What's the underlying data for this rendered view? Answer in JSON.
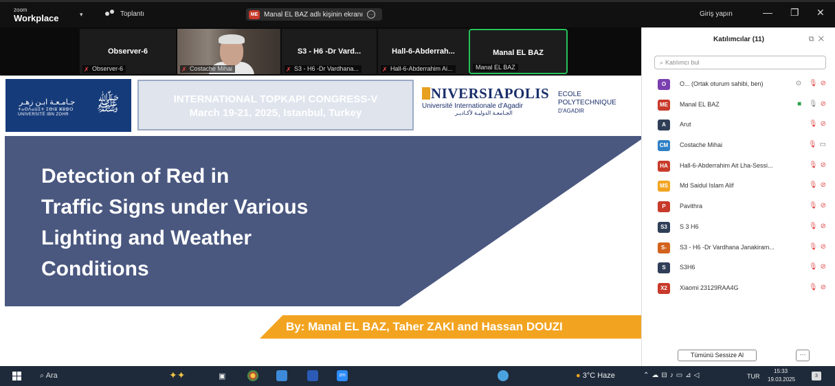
{
  "app": {
    "brand_small": "zoom",
    "brand": "Workplace",
    "meeting_label": "Toplantı",
    "share_initials": "ME",
    "share_text": "Manal EL BAZ adlı kişinin ekranı",
    "login": "Giriş yapın"
  },
  "video_tiles": [
    {
      "title": "Observer-6",
      "caption": "Observer-6"
    },
    {
      "title": "",
      "caption": "Costache Mihai"
    },
    {
      "title": "S3 - H6 -Dr Vard...",
      "caption": "S3 - H6 -Dr Vardhana..."
    },
    {
      "title": "Hall-6-Abderrah...",
      "caption": "Hall-6-Abderrahim Ai..."
    },
    {
      "title": "Manal EL BAZ",
      "caption": "Manal EL BAZ"
    }
  ],
  "slide": {
    "university_ar": "جـامـعـة ابـن زهـر",
    "university_tf": "ⵜⴰⵙⴷⴰⵡⵉⵜ ⵉⴱⵏⵓ ⵣⵓⵀⵔ",
    "university_fr": "UNIVERSITÉ IBN ZOHR",
    "congress_line1": "INTERNATIONAL TOPKAPI CONGRESS-V",
    "congress_line2": "March 19-21, 2025, Istanbul, Turkey",
    "univ_name": "NIVERSIAPOLIS",
    "univ_sub": "Université Internationale d'Agadir",
    "univ_ar": "الجـامعـة الدوليـة لأكـاديـر",
    "ecole_1": "ECOLE",
    "ecole_2": "POLYTECHNIQUE",
    "ecole_3": "D'AGADIR",
    "title_lines": [
      "Detection of Red in",
      "Traffic Signs under Various",
      "Lighting and Weather",
      "Conditions"
    ],
    "authors": "By: Manal EL BAZ, Taher ZAKI and Hassan DOUZI"
  },
  "panel": {
    "title": "Katılımcılar (11)",
    "search_placeholder": "Katılımcı bul",
    "mute_all": "Tümünü Sessize Al",
    "more": "···",
    "participants": [
      {
        "initials": "O",
        "color": "#7b3fb0",
        "name": "O... (Ortak oturum sahibi, ben)"
      },
      {
        "initials": "ME",
        "color": "#c83a2b",
        "name": "Manal EL BAZ"
      },
      {
        "initials": "A",
        "color": "#2f3f57",
        "name": "Arut"
      },
      {
        "initials": "CM",
        "color": "#2f80c6",
        "name": "Costache Mihai"
      },
      {
        "initials": "HA",
        "color": "#c83a2b",
        "name": "Hall-6-Abderrahim Ait Lha-Sessi..."
      },
      {
        "initials": "MS",
        "color": "#f2a421",
        "name": "Md Saidul Islam Alif"
      },
      {
        "initials": "P",
        "color": "#c83a2b",
        "name": "Pavithra"
      },
      {
        "initials": "S3",
        "color": "#2f3f57",
        "name": "S 3 H6"
      },
      {
        "initials": "S-",
        "color": "#d2621e",
        "name": "S3 - H6 -Dr Vardhana Janakiram..."
      },
      {
        "initials": "S",
        "color": "#2f3f57",
        "name": "S3H6"
      },
      {
        "initials": "X2",
        "color": "#c83a2b",
        "name": "Xiaomi 23129RAA4G"
      }
    ]
  },
  "taskbar": {
    "search": "Ara",
    "weather": "3°C Hazе",
    "lang": "TUR",
    "time": "15:33",
    "date": "19.03.2025",
    "notif_count": "3"
  }
}
